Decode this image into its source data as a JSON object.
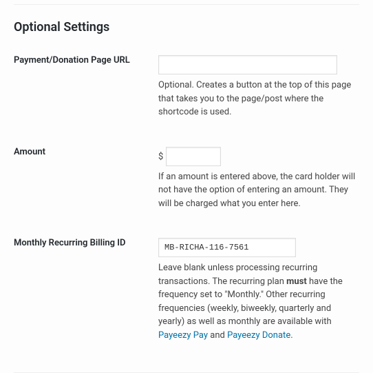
{
  "section_title": "Optional Settings",
  "fields": {
    "page_url": {
      "label": "Payment/Donation Page URL",
      "value": "",
      "description": "Optional. Creates a button at the top of this page that takes you to the page/post where the shortcode is used."
    },
    "amount": {
      "label": "Amount",
      "currency": "$",
      "value": "",
      "description": "If an amount is entered above, the card holder will not have the option of entering an amount. They will be charged what you enter here."
    },
    "recurring_id": {
      "label": "Monthly Recurring Billing ID",
      "value": "MB-RICHA-116-7561",
      "desc_pre": "Leave blank unless processing recurring transactions. The recurring plan ",
      "desc_must": "must",
      "desc_mid": " have the frequency set to \"Monthly.\" Other recurring frequencies (weekly, biweekly, quarterly and yearly) as well as monthly are available with ",
      "link1": "Payeezy Pay",
      "desc_and": " and ",
      "link2": "Payeezy Donate",
      "desc_end": "."
    }
  }
}
